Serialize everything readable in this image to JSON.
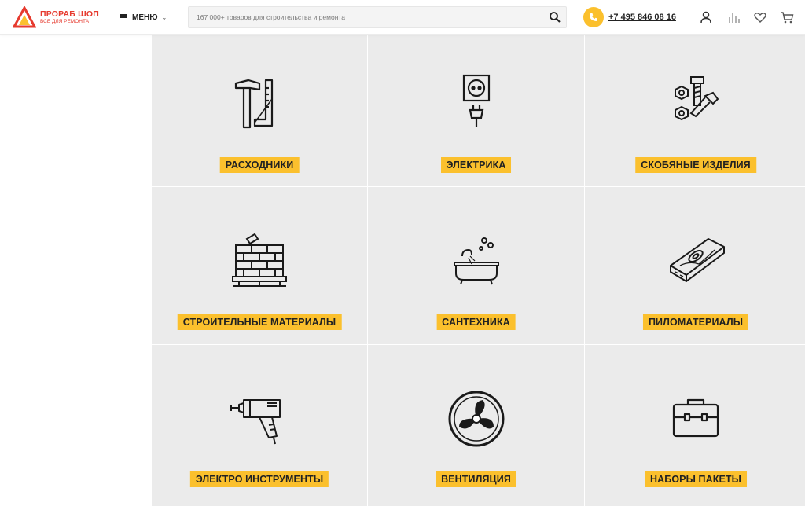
{
  "header": {
    "logo": {
      "title": "ПРОРАБ ШОП",
      "subtitle": "ВСЕ ДЛЯ РЕМОНТА",
      "color": "#e63a2e"
    },
    "menu_label": "МЕНЮ",
    "search": {
      "placeholder": "167 000+ товаров для строительства и ремонта",
      "icon": "search-icon"
    },
    "phone": "+7 495 846 08 16",
    "accent": "#fbc02d",
    "icons": [
      "user-icon",
      "compare-icon",
      "heart-icon",
      "cart-icon"
    ]
  },
  "categories": [
    {
      "label": "РАСХОДНИКИ",
      "icon": "hammer-ruler-icon"
    },
    {
      "label": "ЭЛЕКТРИКА",
      "icon": "socket-plug-icon"
    },
    {
      "label": "СКОБЯНЫЕ ИЗДЕЛИЯ",
      "icon": "bolts-nuts-icon"
    },
    {
      "label": "СТРОИТЕЛЬНЫЕ МАТЕРИАЛЫ",
      "icon": "bricks-icon"
    },
    {
      "label": "САНТЕХНИКА",
      "icon": "bathtub-icon"
    },
    {
      "label": "ПИЛОМАТЕРИАЛЫ",
      "icon": "wood-plank-icon"
    },
    {
      "label": "ЭЛЕКТРО ИНСТРУМЕНТЫ",
      "icon": "glue-gun-icon"
    },
    {
      "label": "ВЕНТИЛЯЦИЯ",
      "icon": "fan-icon"
    },
    {
      "label": "НАБОРЫ ПАКЕТЫ",
      "icon": "toolbox-icon"
    }
  ]
}
